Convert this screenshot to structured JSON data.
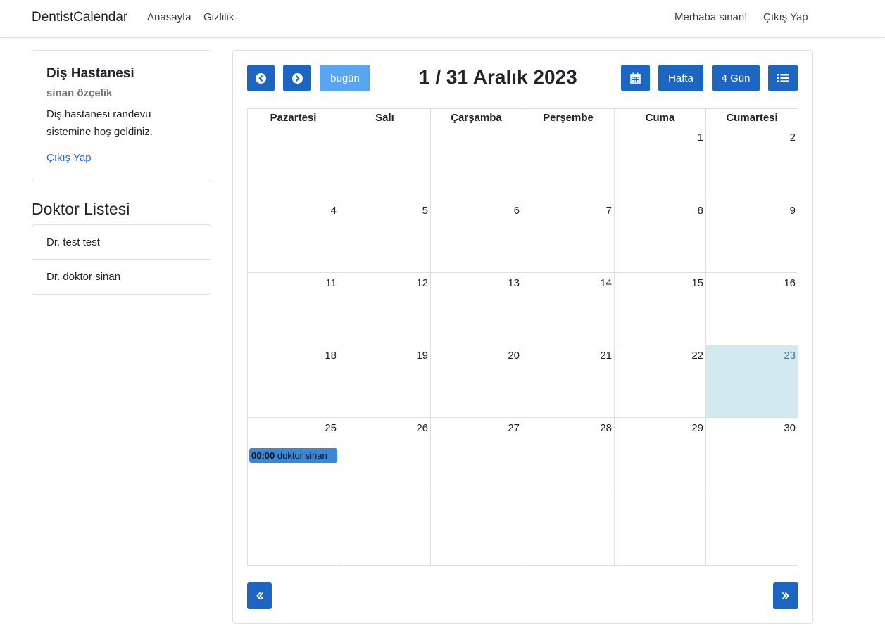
{
  "nav": {
    "brand": "DentistCalendar",
    "links": [
      "Anasayfa",
      "Gizlilik"
    ],
    "greeting": "Merhaba sinan!",
    "logout": "Çıkış Yap"
  },
  "info_card": {
    "title": "Diş Hastanesi",
    "subtitle": "sinan özçelik",
    "text": "Diş hastanesi randevu sistemine hoş geldiniz.",
    "link": "Çıkış Yap"
  },
  "doctors": {
    "title": "Doktor Listesi",
    "items": [
      "Dr. test test",
      "Dr. doktor sinan"
    ]
  },
  "calendar": {
    "title": "1 / 31 Aralık 2023",
    "today_button": "bugün",
    "view_buttons": [
      "Hafta",
      "4 Gün"
    ],
    "day_headers": [
      "Pazartesi",
      "Salı",
      "Çarşamba",
      "Perşembe",
      "Cuma",
      "Cumartesi"
    ],
    "weeks": [
      [
        "",
        "",
        "",
        "",
        "1",
        "2"
      ],
      [
        "4",
        "5",
        "6",
        "7",
        "8",
        "9"
      ],
      [
        "11",
        "12",
        "13",
        "14",
        "15",
        "16"
      ],
      [
        "18",
        "19",
        "20",
        "21",
        "22",
        "23"
      ],
      [
        "25",
        "26",
        "27",
        "28",
        "29",
        "30"
      ],
      [
        "",
        "",
        "",
        "",
        "",
        ""
      ]
    ],
    "today": "23",
    "event": {
      "time": "00:00",
      "title": "doktor sinan",
      "day": "25"
    }
  },
  "colors": {
    "primary": "#1c65c0",
    "light_button": "#58a6f2",
    "today_bg": "#d2eaef",
    "event": "#3a87d6"
  }
}
